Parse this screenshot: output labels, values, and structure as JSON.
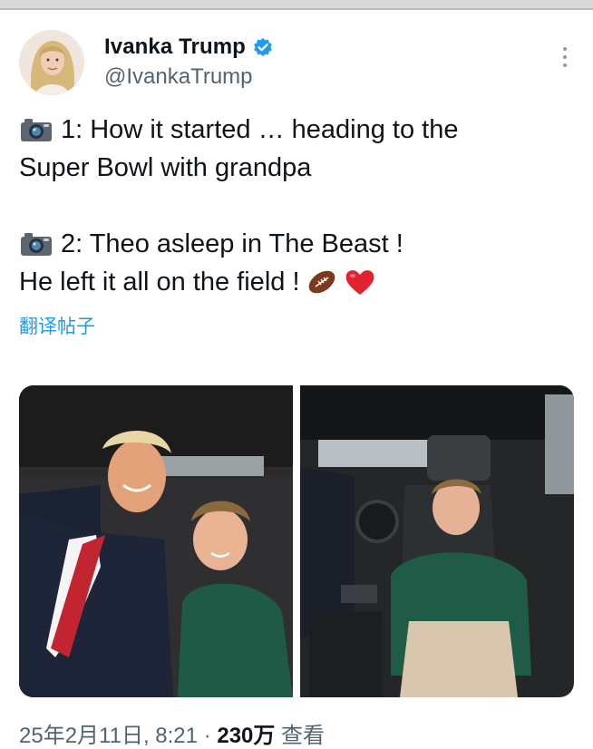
{
  "tweet": {
    "author": {
      "display_name": "Ivanka Trump",
      "handle": "@IvankaTrump",
      "verified": true,
      "verified_color": "#1d9bf0"
    },
    "lines": [
      "1: How it started … heading to the",
      "Super Bowl with grandpa",
      "2: Theo asleep in The Beast !",
      "He left it all on the field !"
    ],
    "line_icons": {
      "line1": "camera-emoji",
      "line3": "camera-emoji",
      "line4_end": [
        "football-emoji",
        "red-heart-emoji"
      ]
    },
    "translate_label": "翻译帖子",
    "media": [
      {
        "alt_name": "photo-grandpa-and-grandson-in-car"
      },
      {
        "alt_name": "photo-boy-asleep-in-car"
      }
    ],
    "footer": {
      "date": "25年2月11日, 8:21 · ",
      "views_count": "230万",
      "views_label": " 查看"
    }
  },
  "colors": {
    "link": "#1d9bf0",
    "secondary_text": "#536471",
    "primary_text": "#0f1419"
  }
}
